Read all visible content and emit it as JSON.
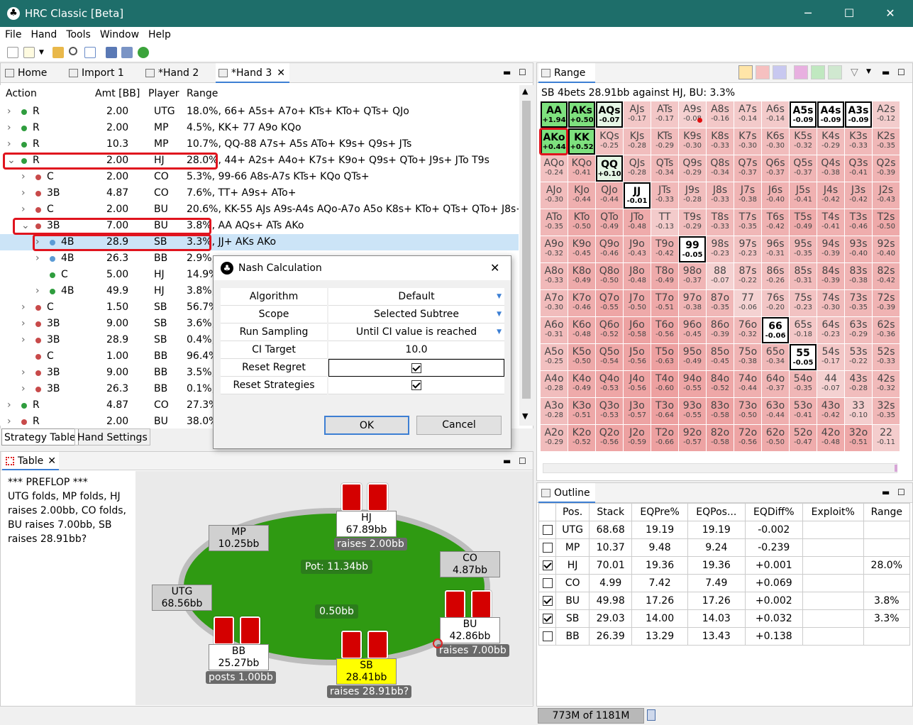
{
  "app": {
    "title": "HRC Classic [Beta]"
  },
  "menu": [
    "File",
    "Hand",
    "Tools",
    "Window",
    "Help"
  ],
  "tabs": {
    "home": "Home",
    "import": "Import 1",
    "hand2": "*Hand 2",
    "hand3": "*Hand 3"
  },
  "tree": {
    "headers": [
      "Action",
      "Amt [BB]",
      "Player",
      "Range"
    ],
    "rows": [
      {
        "a": "R",
        "amt": "2.00",
        "p": "UTG",
        "r": "18.0%, 66+ A5s+ A7o+ KTs+ KTo+ QTs+ QJo",
        "d": 0,
        "c": "g",
        "e": ">"
      },
      {
        "a": "R",
        "amt": "2.00",
        "p": "MP",
        "r": "4.5%, KK+ 77 A9o KQo",
        "d": 0,
        "c": "g",
        "e": ">"
      },
      {
        "a": "R",
        "amt": "10.3",
        "p": "MP",
        "r": "10.7%, QQ-88 A7s+ A5s ATo+ K9s+ Q9s+ JTs",
        "d": 0,
        "c": "g",
        "e": ">"
      },
      {
        "a": "R",
        "amt": "2.00",
        "p": "HJ",
        "r": "28.0%, 44+ A2s+ A4o+ K7s+ K9o+ Q9s+ QTo+ J9s+ JTo T9s",
        "d": 0,
        "c": "g",
        "e": "v"
      },
      {
        "a": "C",
        "amt": "2.00",
        "p": "CO",
        "r": "5.3%, 99-66 A8s-A7s KTs+ KQo QTs+",
        "d": 1,
        "c": "r",
        "e": ">"
      },
      {
        "a": "3B",
        "amt": "4.87",
        "p": "CO",
        "r": "7.6%, TT+ A9s+ ATo+",
        "d": 1,
        "c": "r",
        "e": ">"
      },
      {
        "a": "C",
        "amt": "2.00",
        "p": "BU",
        "r": "20.6%, KK-55 AJs A9s-A4s AQo-A7o A5o K8s+ KTo+ QTs+ QTo+ J8s+...",
        "d": 1,
        "c": "r",
        "e": ">"
      },
      {
        "a": "3B",
        "amt": "7.00",
        "p": "BU",
        "r": "3.8%, AA AQs+ ATs AKo",
        "d": 1,
        "c": "r",
        "e": "v"
      },
      {
        "a": "4B",
        "amt": "28.9",
        "p": "SB",
        "r": "3.3%, JJ+ AKs AKo",
        "d": 2,
        "c": "b",
        "e": ">"
      },
      {
        "a": "4B",
        "amt": "26.3",
        "p": "BB",
        "r": "2.9%,",
        "d": 2,
        "c": "b",
        "e": ">"
      },
      {
        "a": "C",
        "amt": "5.00",
        "p": "HJ",
        "r": "14.9%",
        "d": 2,
        "c": "g",
        "e": ""
      },
      {
        "a": "4B",
        "amt": "49.9",
        "p": "HJ",
        "r": "3.8%,",
        "d": 2,
        "c": "g",
        "e": ">"
      },
      {
        "a": "C",
        "amt": "1.50",
        "p": "SB",
        "r": "56.7%",
        "d": 1,
        "c": "r",
        "e": ">"
      },
      {
        "a": "3B",
        "amt": "9.00",
        "p": "SB",
        "r": "3.6%,",
        "d": 1,
        "c": "r",
        "e": ">"
      },
      {
        "a": "3B",
        "amt": "28.9",
        "p": "SB",
        "r": "0.4%,",
        "d": 1,
        "c": "r",
        "e": ">"
      },
      {
        "a": "C",
        "amt": "1.00",
        "p": "BB",
        "r": "96.4%",
        "d": 1,
        "c": "r",
        "e": ""
      },
      {
        "a": "3B",
        "amt": "9.00",
        "p": "BB",
        "r": "3.5%,",
        "d": 1,
        "c": "r",
        "e": ">"
      },
      {
        "a": "3B",
        "amt": "26.3",
        "p": "BB",
        "r": "0.1%,",
        "d": 1,
        "c": "r",
        "e": ">"
      },
      {
        "a": "R",
        "amt": "4.87",
        "p": "CO",
        "r": "27.3%",
        "d": 0,
        "c": "g",
        "e": ">"
      },
      {
        "a": "R",
        "amt": "2.00",
        "p": "BU",
        "r": "38.0%",
        "d": 0,
        "c": "r",
        "e": ">"
      }
    ]
  },
  "bottomTabs": {
    "strategy": "Strategy Table",
    "hand": "Hand Settings"
  },
  "tablePanel": {
    "title": "Table",
    "log": "*** PREFLOP ***\nUTG folds, MP folds, HJ raises 2.00bb, CO folds, BU raises 7.00bb, SB raises 28.91bb?",
    "pot": "Pot:    11.34bb",
    "center": "0.50bb",
    "seats": {
      "mp": [
        "MP",
        "10.25bb"
      ],
      "hj": [
        "HJ",
        "67.89bb"
      ],
      "co": [
        "CO",
        "4.87bb"
      ],
      "utg": [
        "UTG",
        "68.56bb"
      ],
      "bu": [
        "BU",
        "42.86bb"
      ],
      "bb": [
        "BB",
        "25.27bb"
      ],
      "sb": [
        "SB",
        "28.41bb"
      ]
    },
    "actions": {
      "hj": "raises 2.00bb",
      "bu": "raises 7.00bb",
      "bb": "posts 1.00bb",
      "sb": "raises 28.91bb?"
    }
  },
  "dialog": {
    "title": "Nash Calculation",
    "rows": [
      [
        "Algorithm",
        "Default"
      ],
      [
        "Scope",
        "Selected Subtree"
      ],
      [
        "Run Sampling",
        "Until CI value is reached"
      ],
      [
        "CI Target",
        "10.0"
      ],
      [
        "Reset Regret",
        ""
      ],
      [
        "Reset Strategies",
        ""
      ]
    ],
    "ok": "OK",
    "cancel": "Cancel"
  },
  "range": {
    "title": "Range",
    "subtitle": "SB 4bets 28.91bb against HJ, BU: 3.3%",
    "grid": [
      [
        "AA|+1.94",
        "AKs|+0.50",
        "AQs|-0.07",
        "AJs|-0.17",
        "ATs|-0.17",
        "A9s|-0.08",
        "A8s|-0.16",
        "A7s|-0.14",
        "A6s|-0.14",
        "A5s|-0.09",
        "A4s|-0.09",
        "A3s|-0.09",
        "A2s|-0.12"
      ],
      [
        "AKo|+0.44",
        "KK|+0.52",
        "KQs|-0.25",
        "KJs|-0.28",
        "KTs|-0.29",
        "K9s|-0.30",
        "K8s|-0.33",
        "K7s|-0.30",
        "K6s|-0.30",
        "K5s|-0.32",
        "K4s|-0.29",
        "K3s|-0.33",
        "K2s|-0.35"
      ],
      [
        "AQo|-0.24",
        "KQo|-0.41",
        "QQ|+0.10",
        "QJs|-0.28",
        "QTs|-0.34",
        "Q9s|-0.29",
        "Q8s|-0.34",
        "Q7s|-0.37",
        "Q6s|-0.37",
        "Q5s|-0.37",
        "Q4s|-0.38",
        "Q3s|-0.41",
        "Q2s|-0.39"
      ],
      [
        "AJo|-0.30",
        "KJo|-0.44",
        "QJo|-0.44",
        "JJ|-0.01",
        "JTs|-0.33",
        "J9s|-0.28",
        "J8s|-0.33",
        "J7s|-0.38",
        "J6s|-0.40",
        "J5s|-0.41",
        "J4s|-0.42",
        "J3s|-0.42",
        "J2s|-0.43"
      ],
      [
        "ATo|-0.35",
        "KTo|-0.50",
        "QTo|-0.49",
        "JTo|-0.48",
        "TT|-0.13",
        "T9s|-0.29",
        "T8s|-0.33",
        "T7s|-0.35",
        "T6s|-0.42",
        "T5s|-0.49",
        "T4s|-0.41",
        "T3s|-0.46",
        "T2s|-0.50"
      ],
      [
        "A9o|-0.32",
        "K9o|-0.45",
        "Q9o|-0.46",
        "J9o|-0.43",
        "T9o|-0.42",
        "99|-0.05",
        "98s|-0.23",
        "97s|-0.23",
        "96s|-0.31",
        "95s|-0.35",
        "94s|-0.39",
        "93s|-0.40",
        "92s|-0.40"
      ],
      [
        "A8o|-0.33",
        "K8o|-0.49",
        "Q8o|-0.50",
        "J8o|-0.48",
        "T8o|-0.49",
        "98o|-0.37",
        "88|-0.07",
        "87s|-0.22",
        "86s|-0.26",
        "85s|-0.31",
        "84s|-0.39",
        "83s|-0.38",
        "82s|-0.42"
      ],
      [
        "A7o|-0.30",
        "K7o|-0.46",
        "Q7o|-0.55",
        "J7o|-0.50",
        "T7o|-0.51",
        "97o|-0.38",
        "87o|-0.35",
        "77|-0.06",
        "76s|-0.20",
        "75s|-0.23",
        "74s|-0.30",
        "73s|-0.35",
        "72s|-0.39"
      ],
      [
        "A6o|-0.31",
        "K6o|-0.48",
        "Q6o|-0.52",
        "J6o|-0.58",
        "T6o|-0.56",
        "96o|-0.45",
        "86o|-0.39",
        "76o|-0.32",
        "66|-0.06",
        "65s|-0.18",
        "64s|-0.23",
        "63s|-0.29",
        "62s|-0.36"
      ],
      [
        "A5o|-0.25",
        "K5o|-0.50",
        "Q5o|-0.54",
        "J5o|-0.56",
        "T5o|-0.63",
        "95o|-0.49",
        "85o|-0.45",
        "75o|-0.38",
        "65o|-0.34",
        "55|-0.05",
        "54s|-0.17",
        "53s|-0.22",
        "52s|-0.33"
      ],
      [
        "A4o|-0.28",
        "K4o|-0.49",
        "Q4o|-0.53",
        "J4o|-0.56",
        "T4o|-0.60",
        "94o|-0.55",
        "84o|-0.52",
        "74o|-0.44",
        "64o|-0.37",
        "54o|-0.35",
        "44|-0.07",
        "43s|-0.28",
        "42s|-0.32"
      ],
      [
        "A3o|-0.28",
        "K3o|-0.51",
        "Q3o|-0.53",
        "J3o|-0.57",
        "T3o|-0.64",
        "93o|-0.55",
        "83o|-0.58",
        "73o|-0.50",
        "63o|-0.44",
        "53o|-0.41",
        "43o|-0.42",
        "33|-0.10",
        "32s|-0.35"
      ],
      [
        "A2o|-0.29",
        "K2o|-0.52",
        "Q2o|-0.56",
        "J2o|-0.59",
        "T2o|-0.66",
        "92o|-0.57",
        "82o|-0.58",
        "72o|-0.56",
        "62o|-0.50",
        "52o|-0.47",
        "42o|-0.48",
        "32o|-0.51",
        "22|-0.11"
      ]
    ],
    "green": [
      "AA",
      "AKs",
      "AKo",
      "KK"
    ],
    "boxed": [
      "AQs",
      "A5s",
      "A4s",
      "A3s",
      "QQ",
      "JJ",
      "99",
      "66",
      "55"
    ]
  },
  "outline": {
    "title": "Outline",
    "headers": [
      "Pos.",
      "Stack",
      "EQPre%",
      "EQPos...",
      "EQDiff%",
      "Exploit%",
      "Range"
    ],
    "rows": [
      {
        "chk": false,
        "pos": "UTG",
        "stack": "68.68",
        "pre": "19.19",
        "post": "19.19",
        "diff": "-0.002",
        "exp": "",
        "range": ""
      },
      {
        "chk": false,
        "pos": "MP",
        "stack": "10.37",
        "pre": "9.48",
        "post": "9.24",
        "diff": "-0.239",
        "exp": "",
        "range": ""
      },
      {
        "chk": true,
        "pos": "HJ",
        "stack": "70.01",
        "pre": "19.36",
        "post": "19.36",
        "diff": "+0.001",
        "exp": "",
        "range": "28.0%"
      },
      {
        "chk": false,
        "pos": "CO",
        "stack": "4.99",
        "pre": "7.42",
        "post": "7.49",
        "diff": "+0.069",
        "exp": "",
        "range": ""
      },
      {
        "chk": true,
        "pos": "BU",
        "stack": "49.98",
        "pre": "17.26",
        "post": "17.26",
        "diff": "+0.002",
        "exp": "",
        "range": "3.8%"
      },
      {
        "chk": true,
        "pos": "SB",
        "stack": "29.03",
        "pre": "14.00",
        "post": "14.03",
        "diff": "+0.032",
        "exp": "",
        "range": "3.3%"
      },
      {
        "chk": false,
        "pos": "BB",
        "stack": "26.39",
        "pre": "13.29",
        "post": "13.43",
        "diff": "+0.138",
        "exp": "",
        "range": ""
      }
    ]
  },
  "status": {
    "memory": "773M of 1181M"
  }
}
